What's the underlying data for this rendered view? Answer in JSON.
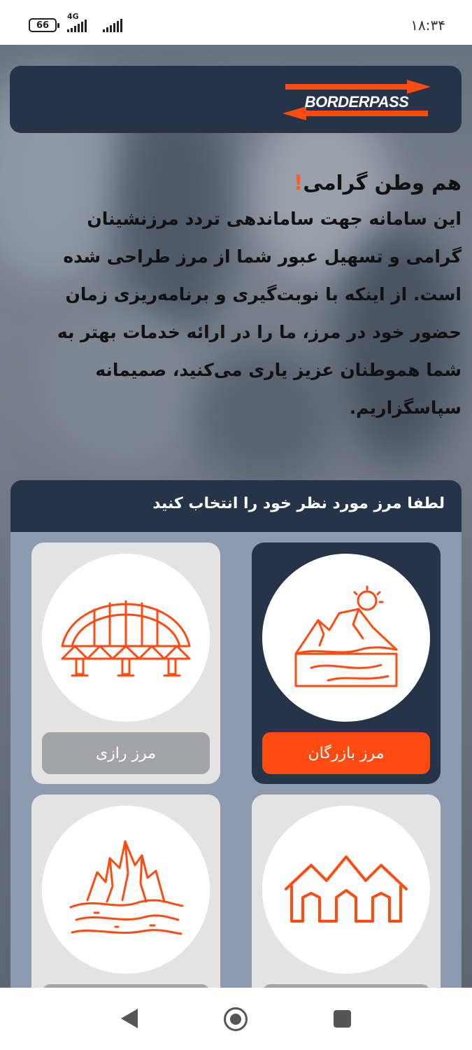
{
  "status_bar": {
    "battery": "66",
    "network": "4G",
    "time": "۱۸:۳۴"
  },
  "brand": {
    "logo_text": "BORDERPASS",
    "accent_color": "#ff4a12",
    "dark_color": "#26344a"
  },
  "intro": {
    "title": "هم وطن گرامی",
    "title_mark": "!",
    "lines": [
      "این سامانه جهت ساماندهی تردد مرزنشینان",
      "گرامی و تسهیل عبور شما از مرز طراحی شده",
      "است. از اینکه با نوبت‌گیری و برنامه‌ریزی زمان",
      "حضور خود در مرز، ما را در ارائه خدمات بهتر به",
      "شما هموطنان عزیز یاری می‌کنید، صمیمانه",
      "سپاسگزاریم."
    ]
  },
  "border_select": {
    "heading": "لطفا مرز مورد نظر خود را انتخاب کنید",
    "options": [
      {
        "label": "مرز بازرگان",
        "icon": "mountain-sun-icon",
        "selected": true
      },
      {
        "label": "مرز رازی",
        "icon": "bridge-icon",
        "selected": false
      },
      {
        "label": "",
        "icon": "houses-icon",
        "selected": false
      },
      {
        "label": "",
        "icon": "rocky-mountain-icon",
        "selected": false
      }
    ]
  },
  "nav": {
    "back": "back-icon",
    "home": "home-icon",
    "recent": "recent-apps-icon"
  }
}
